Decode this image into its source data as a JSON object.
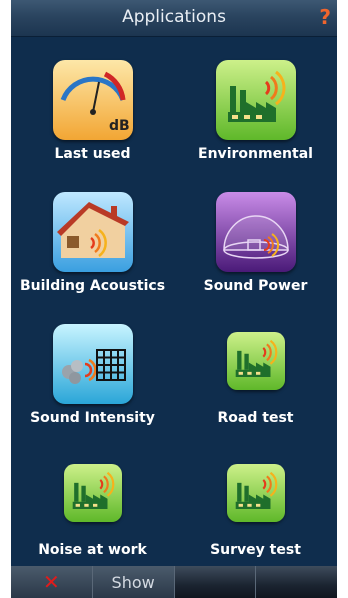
{
  "header": {
    "title": "Applications",
    "help_glyph": "?"
  },
  "apps": [
    {
      "label": "Last used",
      "icon": "sound-level-meter-icon"
    },
    {
      "label": "Environmental",
      "icon": "factory-sound-icon"
    },
    {
      "label": "Building Acoustics",
      "icon": "house-sound-icon"
    },
    {
      "label": "Sound Power",
      "icon": "hemisphere-sound-icon"
    },
    {
      "label": "Sound Intensity",
      "icon": "intensity-grid-icon"
    },
    {
      "label": "Road test",
      "icon": "factory-sound-icon"
    },
    {
      "label": "Noise at work",
      "icon": "factory-sound-icon"
    },
    {
      "label": "Survey test",
      "icon": "factory-sound-icon"
    }
  ],
  "meter": {
    "unit": "dB"
  },
  "softkeys": {
    "cancel_glyph": "✕",
    "show": "Show"
  },
  "colors": {
    "background": "#0f2d4d",
    "help": "#f0652d",
    "cancel": "#e21b1b"
  }
}
